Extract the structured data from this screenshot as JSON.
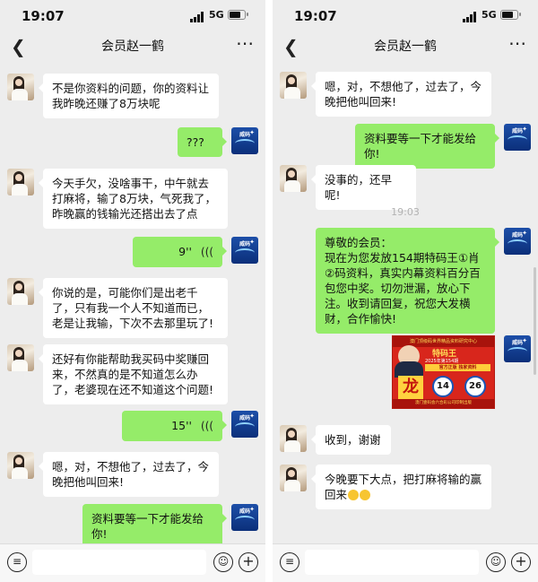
{
  "status": {
    "time": "19:07",
    "network": "5G"
  },
  "chat": {
    "title": "会员赵一鹤"
  },
  "left_messages": [
    {
      "from": "contact",
      "text": "不是你资料的问题，你的资料让我昨晚还赚了8万块呢"
    },
    {
      "from": "me",
      "text": "???"
    },
    {
      "from": "contact",
      "text": "今天手欠，没啥事干，中午就去打麻将，输了8万块，气死我了，昨晚赢的钱输光还搭出去了点"
    },
    {
      "from": "me",
      "type": "voice",
      "duration": "9''"
    },
    {
      "from": "contact",
      "text": "你说的是，可能你们是出老千了，只有我一个人不知道而已，老是让我输，下次不去那里玩了!"
    },
    {
      "from": "contact",
      "text": "还好有你能帮助我买码中奖赚回来，不然真的是不知道怎么办了，老婆现在还不知道这个问题!"
    },
    {
      "from": "me",
      "type": "voice",
      "duration": "15''"
    },
    {
      "from": "contact",
      "text": "嗯，对，不想他了，过去了，今晚把他叫回来!"
    },
    {
      "from": "me",
      "text": "资料要等一下才能发给你!"
    }
  ],
  "right_messages": [
    {
      "from": "contact",
      "text": "嗯，对，不想他了，过去了，今晚把他叫回来!"
    },
    {
      "from": "me",
      "text": "资料要等一下才能发给你!"
    },
    {
      "from": "contact",
      "text": "没事的，还早呢!"
    },
    {
      "type": "timestamp",
      "text": "19:03"
    },
    {
      "from": "me",
      "text": "尊敬的会员：\n现在为您发放154期特码王①肖②码资料，真实内幕资料百分百包您中奖。切勿泄漏，放心下注。收到请回复，祝您大发横财，合作愉快!"
    },
    {
      "from": "me",
      "type": "image"
    },
    {
      "from": "contact",
      "text": "收到，谢谢"
    },
    {
      "from": "contact",
      "text": "今晚要下大点，把打麻将输的赢回来"
    }
  ],
  "image_card": {
    "header": "澳门顶级码世界精品资料研究中心",
    "brand": "特码王",
    "issue": "2025年第154期",
    "banner": "官方正版 独家资料",
    "zodiac": "龙",
    "numbers": [
      "14",
      "26"
    ],
    "footer": "澳门壹码会六合彩公司印制出版"
  },
  "icons": {
    "back": "chevron-left-icon",
    "more": "more-dots-icon",
    "voice_input": "voice-icon",
    "emoji": "emoji-icon",
    "plus": "plus-icon"
  },
  "colors": {
    "outgoing_bubble": "#95ec69",
    "incoming_bubble": "#ffffff",
    "chat_bg": "#ededed"
  }
}
